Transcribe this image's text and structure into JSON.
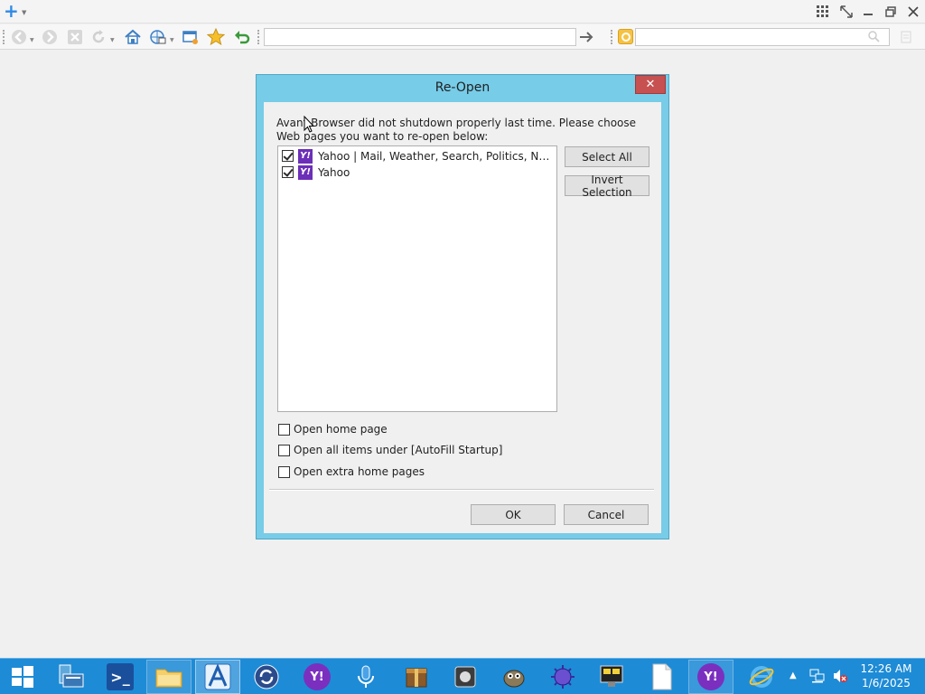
{
  "browser": {
    "address_value": "",
    "search_value": ""
  },
  "dialog": {
    "title": "Re-Open",
    "close_glyph": "✕",
    "message": "Avant Browser did not shutdown properly last time. Please choose Web pages you want to re-open below:",
    "pages": [
      {
        "label": "Yahoo | Mail, Weather, Search, Politics, News, F...",
        "checked": true
      },
      {
        "label": "Yahoo",
        "checked": true
      }
    ],
    "select_all_label": "Select All",
    "invert_selection_label": "Invert Selection",
    "options": [
      {
        "label": "Open home page",
        "checked": false
      },
      {
        "label": "Open all items under [AutoFill Startup]",
        "checked": false
      },
      {
        "label": "Open extra home pages",
        "checked": false
      }
    ],
    "ok_label": "OK",
    "cancel_label": "Cancel"
  },
  "taskbar": {
    "time": "12:26 AM",
    "date": "1/6/2025"
  },
  "colors": {
    "dialog_frame": "#77cce8",
    "close_button": "#c75050",
    "taskbar": "#1e8bd6",
    "yahoo_purple": "#6b2fb8"
  }
}
